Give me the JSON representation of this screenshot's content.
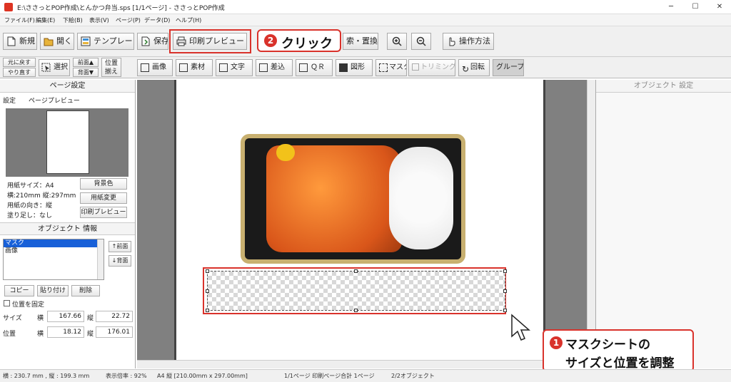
{
  "window": {
    "title": "E:\\ささっとPOP作成\\とんかつ弁当.sps  [1/1ページ] - ささっとPOP作成",
    "minimize": "─",
    "maximize": "☐",
    "close": "✕"
  },
  "menu": [
    "ファイル(F)",
    "編集(E)",
    "下絵(B)",
    "表示(V)",
    "ページ(P)",
    "データ(D)",
    "ヘルプ(H)"
  ],
  "toolbar": {
    "new": "新規",
    "open": "開く",
    "template": "テンプレート",
    "save": "保存",
    "print_preview": "印刷プレビュー",
    "search_replace": "索・置換",
    "help": "操作方法"
  },
  "toolbar2": {
    "undo": "元に戻す",
    "redo": "やり直す",
    "select": "選択",
    "front": "前面▲",
    "back": "背面▼",
    "position": "位置",
    "align": "揃え",
    "image": "画像",
    "material": "素材",
    "text": "文字",
    "insert": "差込",
    "qr": "ＱＲ",
    "shape": "図形",
    "mask": "マスク",
    "trim": "トリミング",
    "rotate": "回転",
    "group": "グループ"
  },
  "page_settings": {
    "header": "ページ設定",
    "tab_settings": "設定",
    "tab_preview": "ページプレビュー",
    "paper_size": "用紙サイズ：A4",
    "dimensions": "横:210mm 縦:297mm",
    "orientation": "用紙の向き：縦",
    "bleed": "塗り足し：なし",
    "bg_color_btn": "背景色",
    "change_paper_btn": "用紙変更",
    "print_preview_btn": "印刷プレビュー"
  },
  "object_info": {
    "header": "オブジェクト 情報",
    "items": [
      "マスク",
      "画像"
    ],
    "front_btn": "↑前面",
    "back_btn": "↓背面",
    "copy_btn": "コピー",
    "paste_btn": "貼り付け",
    "delete_btn": "削除",
    "fix_position": "位置を固定",
    "size_label": "サイズ",
    "pos_label": "位置",
    "w_label": "横",
    "h_label": "縦",
    "size_w": "167.66",
    "size_h": "22.72",
    "pos_x": "18.12",
    "pos_y": "176.01"
  },
  "object_settings": {
    "header": "オブジェクト 設定"
  },
  "status": {
    "coords": "横 : 230.7 mm , 縦 : 199.3 mm",
    "zoom": "表示倍率 : 92%",
    "paper": "A4 縦 [210.00mm x 297.00mm]",
    "pages": "1/1ページ 印刷ページ合計 1ページ",
    "objects": "2/2オブジェクト"
  },
  "callouts": {
    "step1_badge": "1",
    "step1_line1": "マスクシートの",
    "step1_line2": "サイズと位置を調整",
    "step2_badge": "2",
    "step2_text": "クリック"
  },
  "colors": {
    "accent": "#d9322b"
  }
}
